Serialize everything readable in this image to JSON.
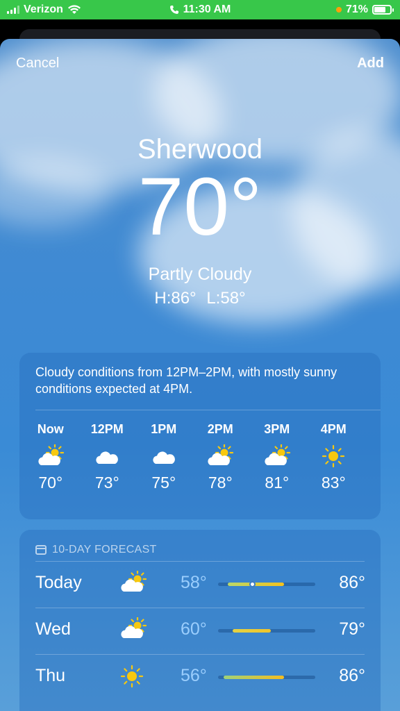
{
  "status_bar": {
    "carrier": "Verizon",
    "time": "11:30 AM",
    "battery": "71%",
    "battery_level": 0.71,
    "icons": [
      "signal-icon",
      "wifi-icon",
      "phone-icon",
      "orange-dot-indicator",
      "battery-icon"
    ]
  },
  "header": {
    "cancel_label": "Cancel",
    "add_label": "Add"
  },
  "current": {
    "city": "Sherwood",
    "temperature": "70°",
    "condition": "Partly Cloudy",
    "high": "H:86°",
    "low": "L:58°"
  },
  "hourly": {
    "summary": "Cloudy conditions from 12PM–2PM, with mostly sunny conditions expected at 4PM.",
    "hours": [
      {
        "label": "Now",
        "icon": "partly-cloudy-icon",
        "temp": "70°"
      },
      {
        "label": "12PM",
        "icon": "cloud-icon",
        "temp": "73°"
      },
      {
        "label": "1PM",
        "icon": "cloud-icon",
        "temp": "75°"
      },
      {
        "label": "2PM",
        "icon": "partly-cloudy-icon",
        "temp": "78°"
      },
      {
        "label": "3PM",
        "icon": "partly-cloudy-icon",
        "temp": "81°"
      },
      {
        "label": "4PM",
        "icon": "sun-icon",
        "temp": "83°"
      }
    ]
  },
  "daily": {
    "heading": "10-DAY FORECAST",
    "days": [
      {
        "name": "Today",
        "icon": "partly-cloudy-icon",
        "low": "58°",
        "high": "86°",
        "range_start": 0.1,
        "range_end": 0.68,
        "current_marker": 0.35,
        "colors": [
          "#b9d86a",
          "#f5c21c"
        ]
      },
      {
        "name": "Wed",
        "icon": "partly-cloudy-icon",
        "low": "60°",
        "high": "79°",
        "range_start": 0.15,
        "range_end": 0.54,
        "colors": [
          "#e4d244",
          "#f0c52a"
        ]
      },
      {
        "name": "Thu",
        "icon": "sun-icon",
        "low": "56°",
        "high": "86°",
        "range_start": 0.06,
        "range_end": 0.68,
        "colors": [
          "#9fd27a",
          "#f5bd1f"
        ]
      }
    ]
  },
  "colors": {
    "status_bar_green": "#38c74a",
    "sun_yellow": "#f7c80f",
    "low_temp_blue": "#a0d2ff"
  }
}
